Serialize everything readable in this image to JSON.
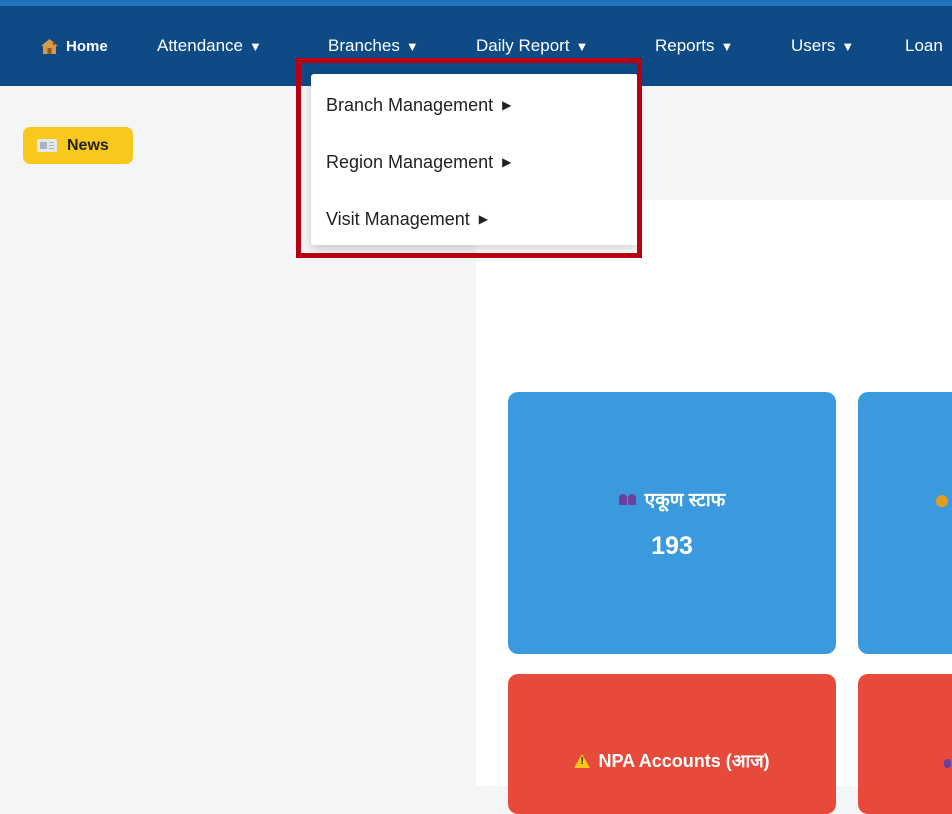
{
  "navbar": {
    "items": [
      {
        "label": "Home",
        "icon": "home-icon"
      },
      {
        "label": "Attendance",
        "caret": "▼"
      },
      {
        "label": "Branches",
        "caret": "▼"
      },
      {
        "label": "Daily Report",
        "caret": "▼"
      },
      {
        "label": "Reports",
        "caret": "▼"
      },
      {
        "label": "Users",
        "caret": "▼"
      },
      {
        "label": "Loan"
      }
    ],
    "background": "#0d4a86"
  },
  "news": {
    "label": "News",
    "icon": "newspaper-icon",
    "color": "#f8c81c"
  },
  "dropdown": {
    "items": [
      {
        "label": "Branch Management",
        "arrow": "▶"
      },
      {
        "label": "Region Management",
        "arrow": "▶"
      },
      {
        "label": "Visit Management",
        "arrow": "▶"
      }
    ]
  },
  "cards": {
    "staff": {
      "title": "एकूण स्टाफ",
      "value": "193",
      "icon": "staff-icon",
      "color": "#3b9ade"
    },
    "npa": {
      "title": "NPA Accounts (आज)",
      "icon": "warning-icon",
      "color": "#e74a3b"
    }
  },
  "highlight_color": "#b8000f"
}
